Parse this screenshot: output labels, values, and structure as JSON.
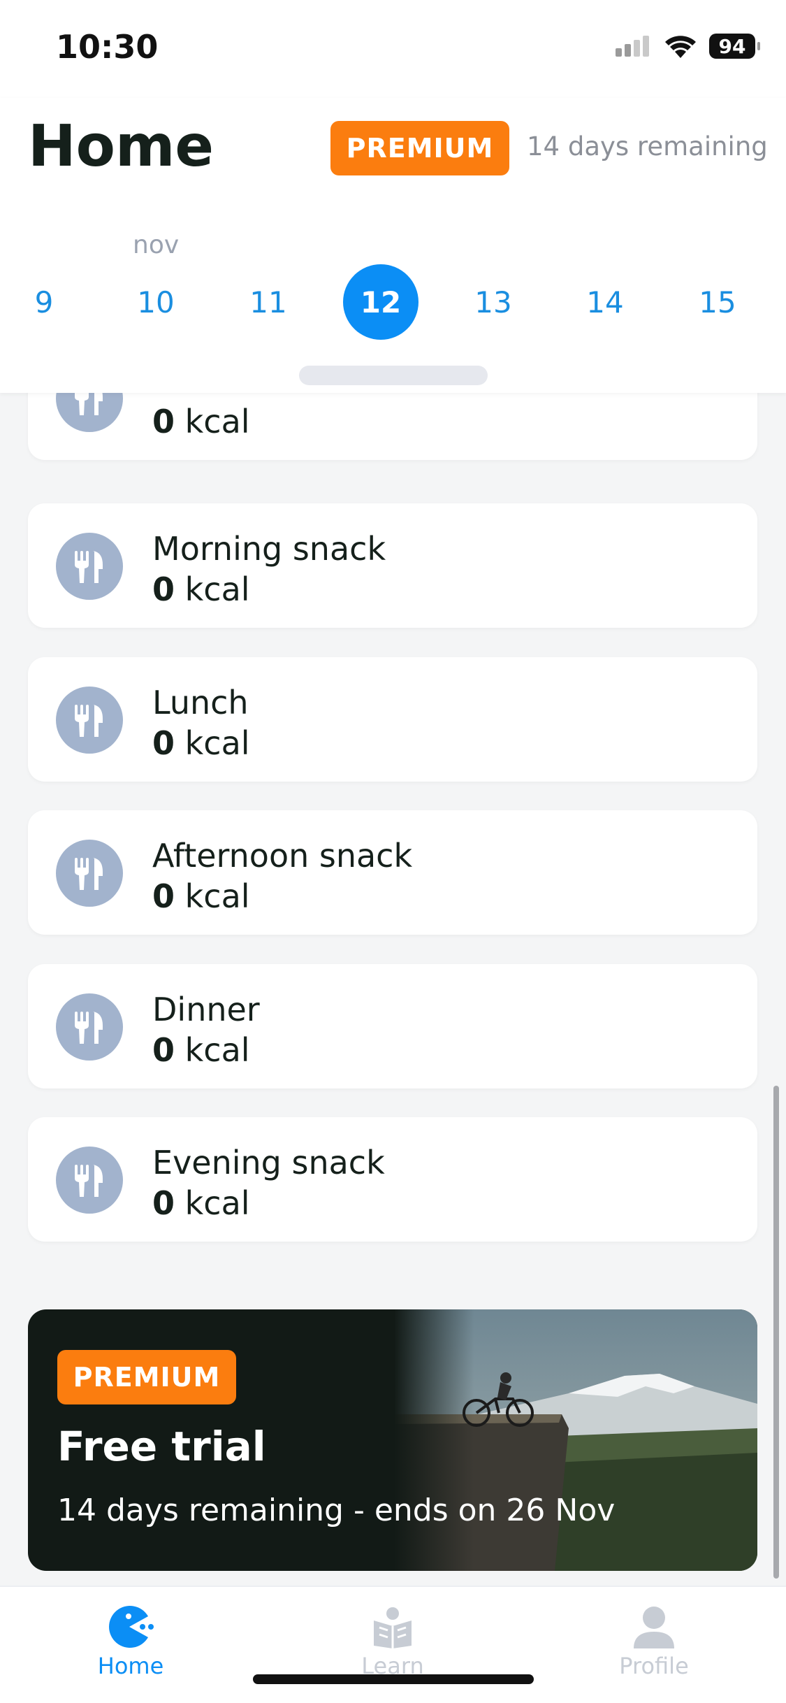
{
  "status_bar": {
    "time": "10:30",
    "battery": "94"
  },
  "header": {
    "title": "Home",
    "premium_label": "PREMIUM",
    "days_remaining": "14 days remaining",
    "month": "nov",
    "dates": [
      "9",
      "10",
      "11",
      "12",
      "13",
      "14",
      "15"
    ],
    "selected_date": "12"
  },
  "meals": [
    {
      "name": "",
      "kcal_value": "0",
      "kcal_unit": "kcal"
    },
    {
      "name": "Morning snack",
      "kcal_value": "0",
      "kcal_unit": "kcal"
    },
    {
      "name": "Lunch",
      "kcal_value": "0",
      "kcal_unit": "kcal"
    },
    {
      "name": "Afternoon snack",
      "kcal_value": "0",
      "kcal_unit": "kcal"
    },
    {
      "name": "Dinner",
      "kcal_value": "0",
      "kcal_unit": "kcal"
    },
    {
      "name": "Evening snack",
      "kcal_value": "0",
      "kcal_unit": "kcal"
    }
  ],
  "promo": {
    "badge": "PREMIUM",
    "title": "Free trial",
    "subtitle": "14 days remaining - ends on 26 Nov"
  },
  "tabs": [
    {
      "label": "Home",
      "icon": "pacman-icon",
      "active": true
    },
    {
      "label": "Learn",
      "icon": "book-icon",
      "active": false
    },
    {
      "label": "Profile",
      "icon": "person-icon",
      "active": false
    }
  ],
  "colors": {
    "accent": "#0b8ef5",
    "premium": "#fb7d0f",
    "meal_icon_bg": "#a2b3cd"
  }
}
